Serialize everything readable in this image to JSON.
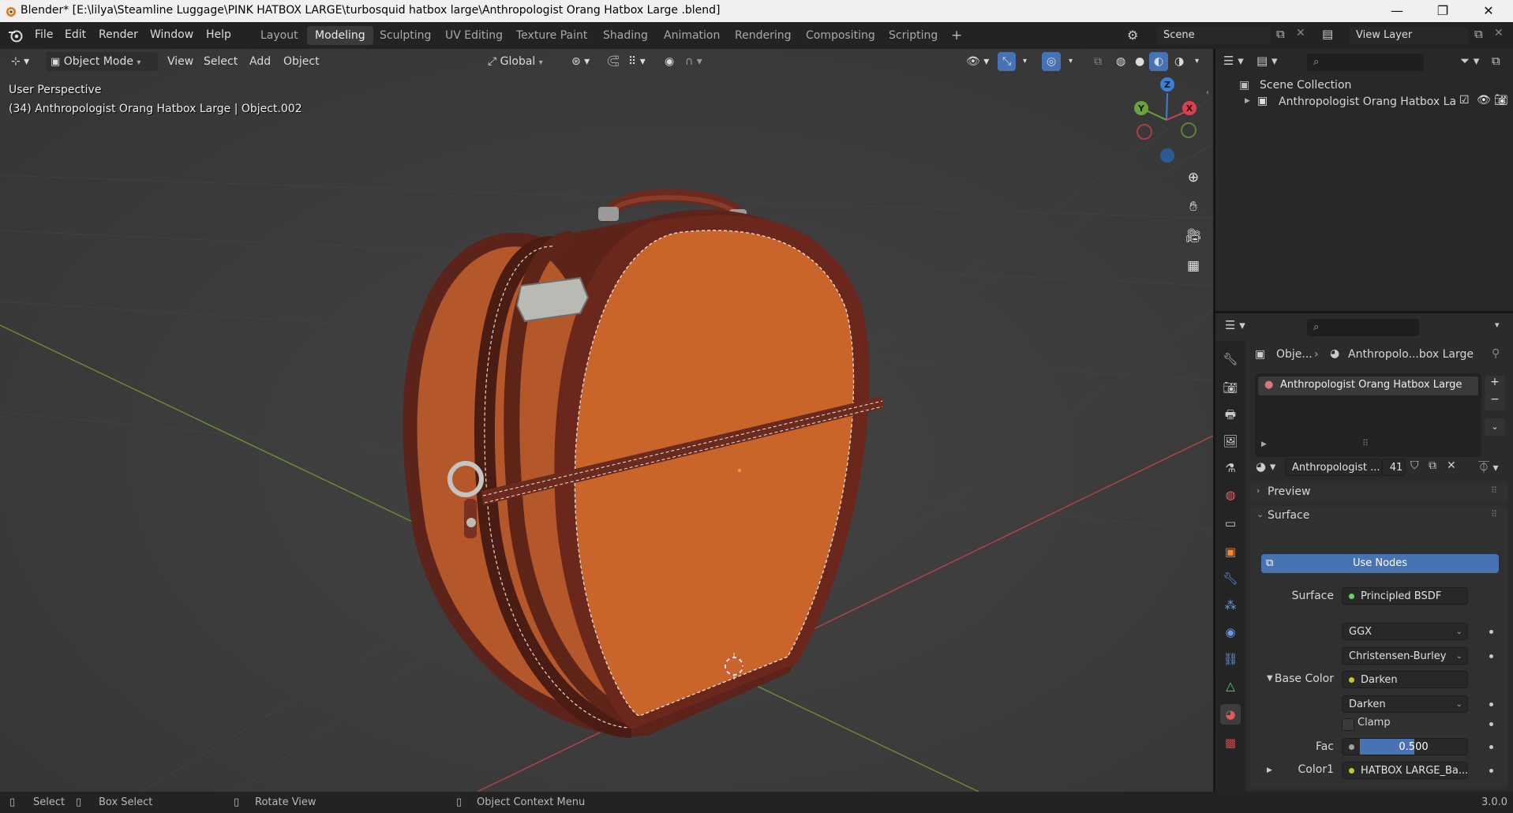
{
  "window": {
    "title": "Blender* [E:\\lilya\\Steamline Luggage\\PINK HATBOX LARGE\\turbosquid hatbox large\\Anthropologist Orang Hatbox Large .blend]",
    "minimize": "—",
    "maximize": "❐",
    "close": "✕"
  },
  "menu": [
    "File",
    "Edit",
    "Render",
    "Window",
    "Help"
  ],
  "workspaces": [
    "Layout",
    "Modeling",
    "Sculpting",
    "UV Editing",
    "Texture Paint",
    "Shading",
    "Animation",
    "Rendering",
    "Compositing",
    "Scripting"
  ],
  "active_workspace": "Modeling",
  "add_workspace": "+",
  "scene": {
    "label": "Scene",
    "view_layer": "View Layer"
  },
  "viewport_header": {
    "mode": "Object Mode",
    "menus": [
      "View",
      "Select",
      "Add",
      "Object"
    ],
    "orientation": "Global"
  },
  "viewport": {
    "perspective": "User Perspective",
    "object_info": "(34) Anthropologist Orang Hatbox Large  | Object.002",
    "gizmo_axes": {
      "z": "Z",
      "y": "Y",
      "x": "X"
    }
  },
  "outliner": {
    "root": "Scene Collection",
    "items": [
      {
        "label": "Anthropologist Orang Hatbox Lar"
      }
    ]
  },
  "properties": {
    "breadcrumb": {
      "object": "Obje...",
      "material": "Anthropolo...box Large"
    },
    "material_slots": [
      "Anthropologist Orang Hatbox Large"
    ],
    "material_name": "Anthropologist ...",
    "user_count": "41",
    "panels": {
      "preview": "Preview",
      "surface": "Surface"
    },
    "use_nodes": "Use Nodes",
    "surface_label": "Surface",
    "surface_shader": "Principled BSDF",
    "distribution": "GGX",
    "subsurface": "Christensen-Burley",
    "base_color_label": "Base Color",
    "base_color_value": "Darken",
    "blend_mode": "Darken",
    "clamp_label": "Clamp",
    "fac_label": "Fac",
    "fac_value": "0.500",
    "fac_fraction": 0.5,
    "color1_label": "Color1",
    "color1_value": "HATBOX LARGE_Ba..."
  },
  "statusbar": {
    "select": "Select",
    "box_select": "Box Select",
    "rotate": "Rotate View",
    "context": "Object Context Menu",
    "version": "3.0.0"
  },
  "colors": {
    "accent": "#4772b3",
    "leather": "#c9652b",
    "strap": "#5e2418",
    "x_axis": "#d9414f",
    "y_axis": "#6da13d",
    "z_axis": "#3b7fd6",
    "node_socket": "#c7c729",
    "shader_socket": "#5fd36a"
  }
}
